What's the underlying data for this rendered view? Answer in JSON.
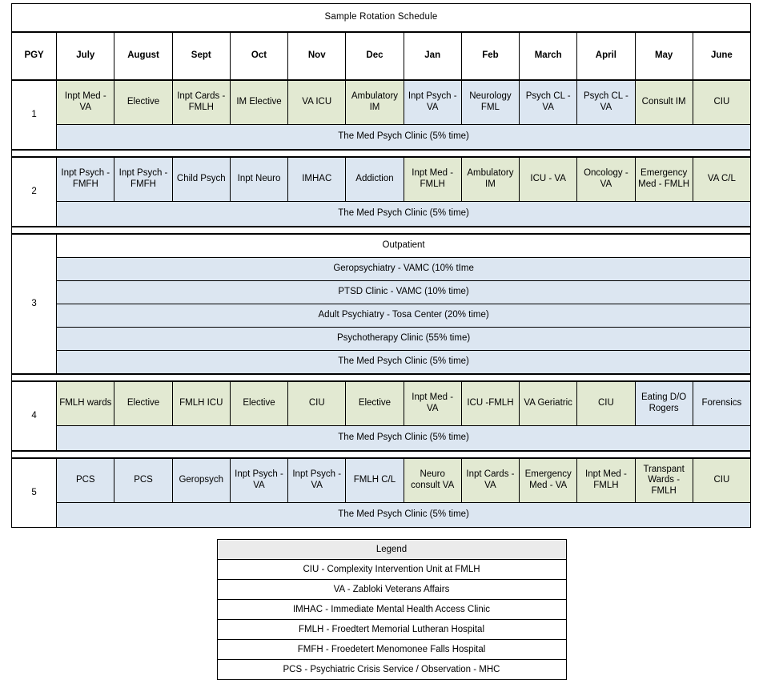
{
  "title": "Sample Rotation Schedule",
  "colors": {
    "medicine_fill": "#e2e9d2",
    "psychiatry_fill": "#dce6f1",
    "legend_header_fill": "#ebebeb",
    "border": "#000000"
  },
  "header": {
    "pgy_label": "PGY",
    "months": [
      "July",
      "August",
      "Sept",
      "Oct",
      "Nov",
      "Dec",
      "Jan",
      "Feb",
      "March",
      "April",
      "May",
      "June"
    ]
  },
  "years": [
    {
      "pgy": "1",
      "rotations": [
        {
          "label": "Inpt Med - VA",
          "fill": "green"
        },
        {
          "label": "Elective",
          "fill": "green"
        },
        {
          "label": "Inpt Cards - FMLH",
          "fill": "green"
        },
        {
          "label": "IM Elective",
          "fill": "green"
        },
        {
          "label": "VA ICU",
          "fill": "green"
        },
        {
          "label": "Ambulatory IM",
          "fill": "green"
        },
        {
          "label": "Inpt Psych - VA",
          "fill": "blue"
        },
        {
          "label": "Neurology FML",
          "fill": "blue"
        },
        {
          "label": "Psych CL - VA",
          "fill": "blue"
        },
        {
          "label": "Psych CL - VA",
          "fill": "blue"
        },
        {
          "label": "Consult IM",
          "fill": "green"
        },
        {
          "label": "CIU",
          "fill": "green"
        }
      ],
      "clinic": {
        "label": "The Med Psych Clinic  (5% time)",
        "fill": "blue"
      }
    },
    {
      "pgy": "2",
      "rotations": [
        {
          "label": "Inpt Psych - FMFH",
          "fill": "blue"
        },
        {
          "label": "Inpt Psych - FMFH",
          "fill": "blue"
        },
        {
          "label": "Child Psych",
          "fill": "blue"
        },
        {
          "label": "Inpt Neuro",
          "fill": "blue"
        },
        {
          "label": "IMHAC",
          "fill": "blue"
        },
        {
          "label": "Addiction",
          "fill": "blue"
        },
        {
          "label": "Inpt Med - FMLH",
          "fill": "green"
        },
        {
          "label": "Ambulatory IM",
          "fill": "green"
        },
        {
          "label": "ICU - VA",
          "fill": "green"
        },
        {
          "label": "Oncology - VA",
          "fill": "green"
        },
        {
          "label": "Emergency Med - FMLH",
          "fill": "green"
        },
        {
          "label": "VA C/L",
          "fill": "green"
        }
      ],
      "clinic": {
        "label": "The Med Psych Clinic  (5% time)",
        "fill": "blue"
      }
    },
    {
      "pgy": "3",
      "outpatient_header": {
        "label": "Outpatient",
        "fill": "white"
      },
      "outpatient_rows": [
        {
          "label": "Geropsychiatry - VAMC (10% tIme",
          "fill": "blue"
        },
        {
          "label": "PTSD Clinic - VAMC (10% time)",
          "fill": "blue"
        },
        {
          "label": "Adult Psychiatry - Tosa Center (20% time)",
          "fill": "blue"
        },
        {
          "label": "Psychotherapy Clinic  (55% time)",
          "fill": "blue"
        },
        {
          "label": "The Med Psych Clinic  (5% time)",
          "fill": "blue"
        }
      ]
    },
    {
      "pgy": "4",
      "rotations": [
        {
          "label": "FMLH wards",
          "fill": "green"
        },
        {
          "label": "Elective",
          "fill": "green"
        },
        {
          "label": "FMLH ICU",
          "fill": "green"
        },
        {
          "label": "Elective",
          "fill": "green"
        },
        {
          "label": "CIU",
          "fill": "green"
        },
        {
          "label": "Elective",
          "fill": "green"
        },
        {
          "label": "Inpt Med - VA",
          "fill": "green"
        },
        {
          "label": "ICU -FMLH",
          "fill": "green"
        },
        {
          "label": "VA Geriatric",
          "fill": "green"
        },
        {
          "label": "CIU",
          "fill": "green"
        },
        {
          "label": "Eating D/O Rogers",
          "fill": "blue"
        },
        {
          "label": "Forensics",
          "fill": "blue"
        }
      ],
      "clinic": {
        "label": "The Med Psych Clinic  (5% time)",
        "fill": "blue"
      }
    },
    {
      "pgy": "5",
      "rotations": [
        {
          "label": "PCS",
          "fill": "blue"
        },
        {
          "label": "PCS",
          "fill": "blue"
        },
        {
          "label": "Geropsych",
          "fill": "blue"
        },
        {
          "label": "Inpt Psych - VA",
          "fill": "blue"
        },
        {
          "label": "Inpt Psych - VA",
          "fill": "blue"
        },
        {
          "label": "FMLH C/L",
          "fill": "blue"
        },
        {
          "label": "Neuro consult VA",
          "fill": "green"
        },
        {
          "label": "Inpt Cards - VA",
          "fill": "green"
        },
        {
          "label": "Emergency Med - VA",
          "fill": "green"
        },
        {
          "label": "Inpt Med - FMLH",
          "fill": "green"
        },
        {
          "label": "Transpant Wards - FMLH",
          "fill": "green"
        },
        {
          "label": "CIU",
          "fill": "green"
        }
      ],
      "clinic": {
        "label": "The Med Psych Clinic  (5% time)",
        "fill": "blue"
      }
    }
  ],
  "legend": {
    "header": "Legend",
    "entries": [
      "CIU - Complexity Intervention Unit at FMLH",
      "VA - Zabloki Veterans Affairs",
      "IMHAC - Immediate Mental Health Access Clinic",
      "FMLH - Froedtert Memorial Lutheran Hospital",
      "FMFH - Froedetert Menomonee Falls Hospital",
      "PCS - Psychiatric Crisis Service / Observation - MHC"
    ]
  }
}
